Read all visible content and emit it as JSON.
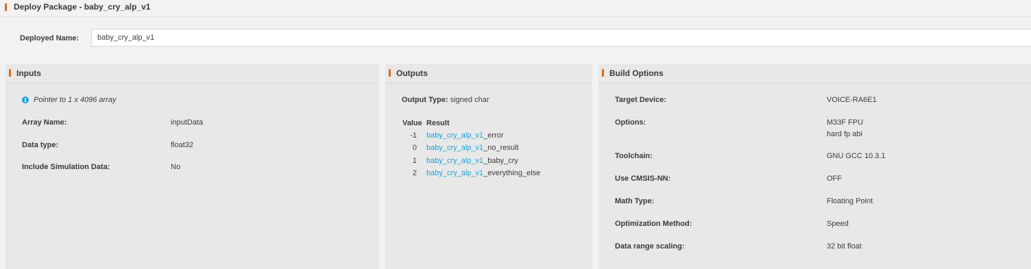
{
  "header": {
    "title": "Deploy Package - baby_cry_alp_v1"
  },
  "deploy": {
    "label": "Deployed Name:",
    "value": "baby_cry_alp_v1"
  },
  "inputs": {
    "title": "Inputs",
    "info": "Pointer to 1 x 4096 array",
    "rows": [
      {
        "label": "Array Name:",
        "value": "inputData"
      },
      {
        "label": "Data type:",
        "value": "float32"
      },
      {
        "label": "Include Simulation Data:",
        "value": "No"
      }
    ]
  },
  "outputs": {
    "title": "Outputs",
    "output_type_label": "Output Type:",
    "output_type_value": "signed char",
    "col_value": "Value",
    "col_result": "Result",
    "rows": [
      {
        "value": "-1",
        "prefix": "baby_cry_alp_v1",
        "suffix": "_error"
      },
      {
        "value": "0",
        "prefix": "baby_cry_alp_v1",
        "suffix": "_no_result"
      },
      {
        "value": "1",
        "prefix": "baby_cry_alp_v1",
        "suffix": "_baby_cry"
      },
      {
        "value": "2",
        "prefix": "baby_cry_alp_v1",
        "suffix": "_everything_else"
      }
    ]
  },
  "build": {
    "title": "Build Options",
    "rows": [
      {
        "label": "Target Device:",
        "value": "VOICE-RA6E1"
      },
      {
        "label": "Options:",
        "value": "M33F FPU",
        "value2": "hard fp abi"
      },
      {
        "label": "Toolchain:",
        "value": "GNU GCC 10.3.1"
      },
      {
        "label": "Use CMSIS-NN:",
        "value": "OFF"
      },
      {
        "label": "Math Type:",
        "value": "Floating Point"
      },
      {
        "label": "Optimization Method:",
        "value": "Speed"
      },
      {
        "label": "Data range scaling:",
        "value": "32 bit float"
      }
    ]
  },
  "colors": {
    "accent": "#e06b10",
    "link": "#1aa3d9",
    "panel": "#e8e8e8"
  },
  "icons": {
    "info": "info-icon"
  }
}
